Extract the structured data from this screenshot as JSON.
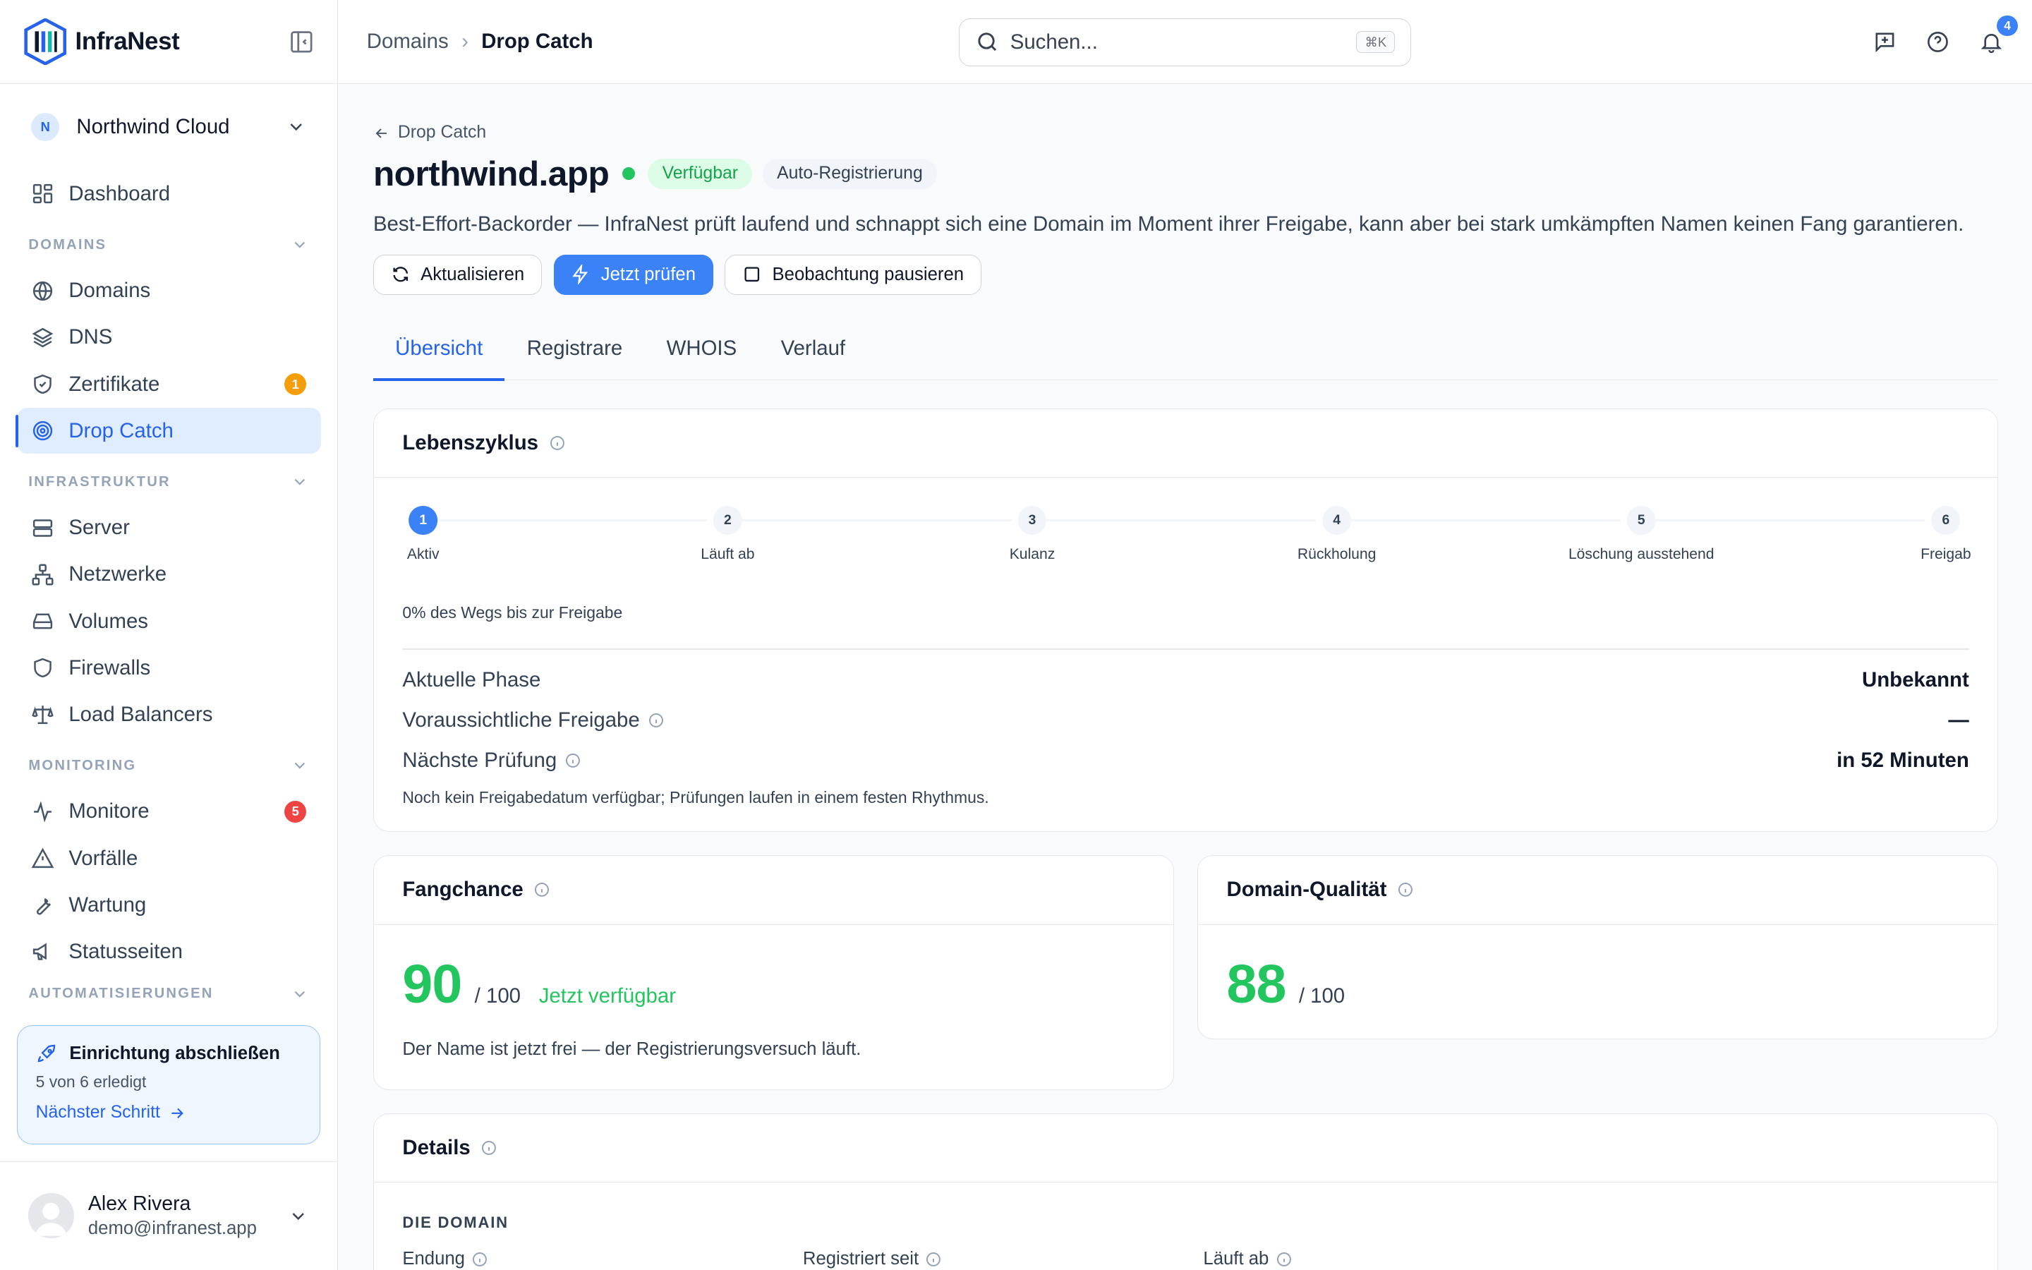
{
  "brand": {
    "name": "InfraNest"
  },
  "org": {
    "initial": "N",
    "name": "Northwind Cloud"
  },
  "nav": {
    "dashboard": "Dashboard",
    "sections": {
      "domains": "DOMAINS",
      "infra": "INFRASTRUKTUR",
      "monitoring": "MONITORING",
      "automation": "AUTOMATISIERUNGEN"
    },
    "domains": "Domains",
    "dns": "DNS",
    "certs": "Zertifikate",
    "certs_badge": "1",
    "dropcatch": "Drop Catch",
    "server": "Server",
    "networks": "Netzwerke",
    "volumes": "Volumes",
    "firewalls": "Firewalls",
    "lb": "Load Balancers",
    "monitors": "Monitore",
    "monitors_badge": "5",
    "incidents": "Vorfälle",
    "maintenance": "Wartung",
    "statuspages": "Statusseiten"
  },
  "setup": {
    "title": "Einrichtung abschließen",
    "progress": "5 von 6 erledigt",
    "link": "Nächster Schritt"
  },
  "user": {
    "name": "Alex Rivera",
    "email": "demo@infranest.app"
  },
  "topbar": {
    "crumb_parent": "Domains",
    "crumb_sep": "›",
    "crumb_current": "Drop Catch",
    "search_placeholder": "Suchen...",
    "shortcut": "⌘K",
    "notif_count": "4"
  },
  "page": {
    "back": "Drop Catch",
    "title": "northwind.app",
    "status": "Verfügbar",
    "mode": "Auto-Registrierung",
    "description": "Best-Effort-Backorder — InfraNest prüft laufend und schnappt sich eine Domain im Moment ihrer Freigabe, kann aber bei stark umkämpften Namen keinen Fang garantieren.",
    "btn_refresh": "Aktualisieren",
    "btn_check": "Jetzt prüfen",
    "btn_pause": "Beobachtung pausieren",
    "tabs": [
      "Übersicht",
      "Registrare",
      "WHOIS",
      "Verlauf"
    ]
  },
  "lifecycle": {
    "title": "Lebenszyklus",
    "steps": [
      {
        "n": "1",
        "label": "Aktiv"
      },
      {
        "n": "2",
        "label": "Läuft ab"
      },
      {
        "n": "3",
        "label": "Kulanz"
      },
      {
        "n": "4",
        "label": "Rückholung"
      },
      {
        "n": "5",
        "label": "Löschung ausstehend"
      },
      {
        "n": "6",
        "label": "Freigab"
      }
    ],
    "progress_text": "0% des Wegs bis zur Freigabe",
    "phase_label": "Aktuelle Phase",
    "phase_value": "Unbekannt",
    "release_label": "Voraussichtliche Freigabe",
    "release_value": "—",
    "next_label": "Nächste Prüfung",
    "next_value": "in 52 Minuten",
    "note": "Noch kein Freigabedatum verfügbar; Prüfungen laufen in einem festen Rhythmus."
  },
  "catch": {
    "title": "Fangchance",
    "score": "90",
    "of": "/ 100",
    "status": "Jetzt verfügbar",
    "note": "Der Name ist jetzt frei — der Registrierungsversuch läuft."
  },
  "quality": {
    "title": "Domain-Qualität",
    "score": "88",
    "of": "/ 100"
  },
  "details": {
    "title": "Details",
    "section": "DIE DOMAIN",
    "tld_label": "Endung",
    "registered_label": "Registriert seit",
    "expires_label": "Läuft ab"
  },
  "colors": {
    "accent": "#3b82f6",
    "success": "#22c55e",
    "warning": "#f59e0b",
    "danger": "#ef4444"
  }
}
